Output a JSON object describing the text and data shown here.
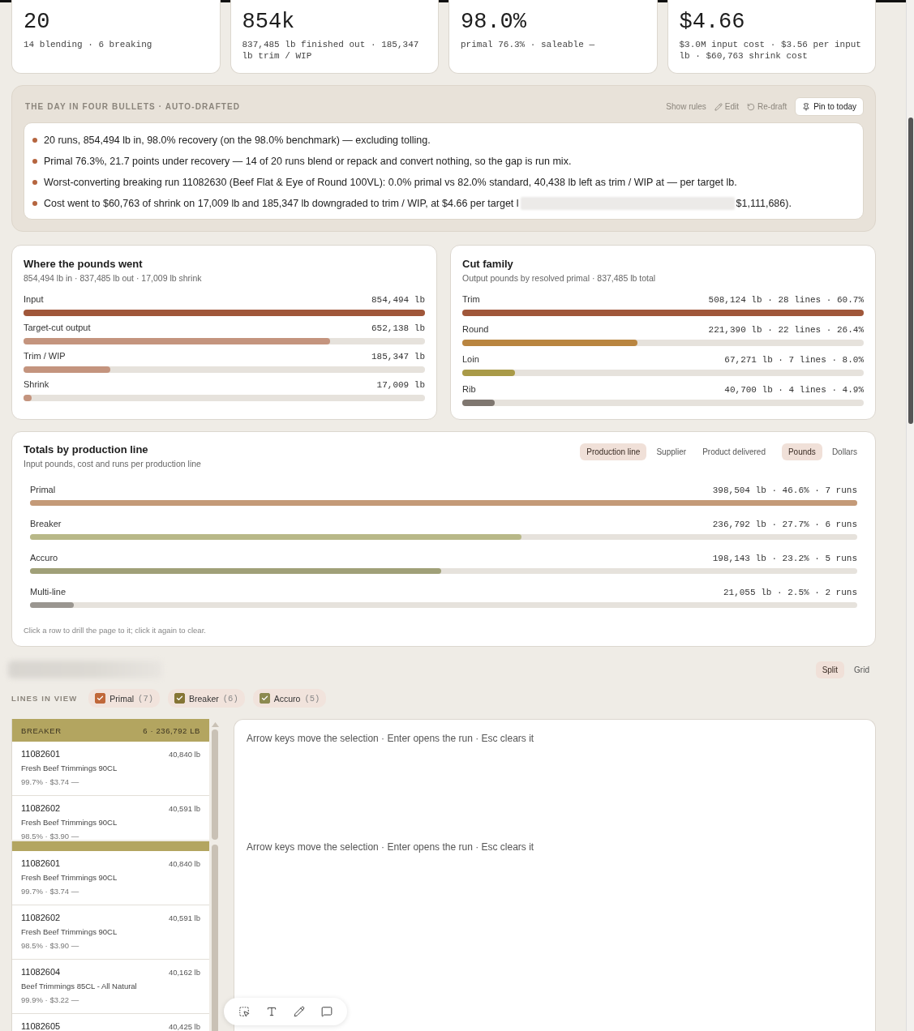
{
  "stat_cards": [
    {
      "value": "20",
      "detail": "14 blending · 6 breaking"
    },
    {
      "value": "854k",
      "detail": "837,485 lb finished out · 185,347 lb trim / WIP"
    },
    {
      "value": "98.0%",
      "detail": "primal 76.3% · saleable —"
    },
    {
      "value": "$4.66",
      "detail": "$3.0M input cost · $3.56 per input lb · $60,763 shrink cost"
    }
  ],
  "bullets_panel": {
    "title": "THE DAY IN FOUR BULLETS · AUTO-DRAFTED",
    "actions": [
      {
        "kind": "text",
        "label": "Show rules"
      },
      {
        "kind": "edit",
        "label": "Edit"
      },
      {
        "kind": "redraft",
        "label": "Re-draft"
      },
      {
        "kind": "pin",
        "label": "Pin to today"
      }
    ],
    "bullets": [
      {
        "text": "20 runs, 854,494 lb in, 98.0% recovery (on the 98.0% benchmark) — excluding tolling."
      },
      {
        "text": "Primal 76.3%, 21.7 points under recovery — 14 of 20 runs blend or repack and convert nothing, so the gap is run mix."
      },
      {
        "text": "Worst-converting breaking run 11082630 (Beef Flat & Eye of Round 100VL): 0.0% primal vs 82.0% standard, 40,438 lb left as trim / WIP at — per target lb."
      },
      {
        "text": "Cost went to $60,763 of shrink on 17,009 lb and 185,347 lb downgraded to trim / WIP, at $4.66 per target l",
        "redacted_tail": "$1,111,686)."
      }
    ]
  },
  "pounds_card": {
    "title": "Where the pounds went",
    "subtitle": "854,494 lb in · 837,485 lb out · 17,009 lb shrink",
    "rows": [
      {
        "label": "Input",
        "value": "854,494 lb",
        "level": 1.0,
        "color": "#a0573a"
      },
      {
        "label": "Target-cut output",
        "value": "652,138 lb",
        "level": 0.763,
        "color": "#c4947e"
      },
      {
        "label": "Trim / WIP",
        "value": "185,347 lb",
        "level": 0.217,
        "color": "#c4947e"
      },
      {
        "label": "Shrink",
        "value": "17,009 lb",
        "level": 0.02,
        "color": "#c4947e"
      }
    ]
  },
  "cut_family_card": {
    "title": "Cut family",
    "subtitle": "Output pounds by resolved primal · 837,485 lb total",
    "rows": [
      {
        "label": "Trim",
        "value": "508,124 lb · 28 lines · 60.7%",
        "level": 1.0,
        "color": "#a0573a"
      },
      {
        "label": "Round",
        "value": "221,390 lb · 22 lines · 26.4%",
        "level": 0.436,
        "color": "#b98540"
      },
      {
        "label": "Loin",
        "value": "67,271 lb · 7 lines · 8.0%",
        "level": 0.132,
        "color": "#a99a48"
      },
      {
        "label": "Rib",
        "value": "40,700 lb · 4 lines · 4.9%",
        "level": 0.08,
        "color": "#7f7770"
      }
    ]
  },
  "totals_card": {
    "title": "Totals by production line",
    "subtitle": "Input pounds, cost and runs per production line",
    "group_by": [
      {
        "label": "Production line",
        "selected": true
      },
      {
        "label": "Supplier",
        "selected": false
      },
      {
        "label": "Product delivered",
        "selected": false
      }
    ],
    "measure": [
      {
        "label": "Pounds",
        "selected": true
      },
      {
        "label": "Dollars",
        "selected": false
      }
    ],
    "rows": [
      {
        "label": "Primal",
        "value": "398,504 lb · 46.6% · 7 runs",
        "level": 1.0,
        "color": "#c49a78"
      },
      {
        "label": "Breaker",
        "value": "236,792 lb · 27.7% · 6 runs",
        "level": 0.594,
        "color": "#b8b888"
      },
      {
        "label": "Accuro",
        "value": "198,143 lb · 23.2% · 5 runs",
        "level": 0.497,
        "color": "#a0a078"
      },
      {
        "label": "Multi-line",
        "value": "21,055 lb · 2.5% · 2 runs",
        "level": 0.053,
        "color": "#9a9690"
      }
    ],
    "footnote": "Click a row to drill the page to it; click it again to clear."
  },
  "view_title_redacted": true,
  "layout_toggle": [
    {
      "label": "Split",
      "selected": true
    },
    {
      "label": "Grid",
      "selected": false
    }
  ],
  "lines_filter": {
    "label": "LINES IN VIEW",
    "lines": [
      {
        "name": "Primal",
        "count": "(7)",
        "checked": true,
        "color": "#c0683a"
      },
      {
        "name": "Breaker",
        "count": "(6)",
        "checked": true,
        "color": "#857535"
      },
      {
        "name": "Accuro",
        "count": "(5)",
        "checked": true,
        "color": "#8c8a50"
      }
    ]
  },
  "run_list_panes": [
    {
      "header": {
        "line": "BREAKER",
        "summary": "6 · 236,792 LB",
        "color": "#b3a560"
      },
      "runs": [
        {
          "id": "11082601",
          "weight": "40,840 lb",
          "product": "Fresh Beef Trimmings 90CL",
          "meta": "99.7% · $3.74 —"
        },
        {
          "id": "11082602",
          "weight": "40,591 lb",
          "product": "Fresh Beef Trimmings 90CL",
          "meta": "98.5% · $3.90 —"
        }
      ]
    },
    {
      "header": {
        "color": "#b3a560"
      },
      "runs": [
        {
          "id": "11082601",
          "weight": "40,840 lb",
          "product": "Fresh Beef Trimmings 90CL",
          "meta": "99.7% · $3.74 —"
        },
        {
          "id": "11082602",
          "weight": "40,591 lb",
          "product": "Fresh Beef Trimmings 90CL",
          "meta": "98.5% · $3.90 —"
        },
        {
          "id": "11082604",
          "weight": "40,162 lb",
          "product": "Beef Trimmings 85CL - All Natural",
          "meta": "99.9% · $3.22 —"
        },
        {
          "id": "11082605",
          "weight": "40,425 lb"
        }
      ]
    }
  ],
  "detail_hints": [
    "Arrow keys move the selection · Enter opens the run · Esc clears it",
    "Arrow keys move the selection · Enter opens the run · Esc clears it"
  ],
  "floating_toolbar": [
    {
      "kind": "select"
    },
    {
      "kind": "text"
    },
    {
      "kind": "draw"
    },
    {
      "kind": "comment"
    }
  ]
}
